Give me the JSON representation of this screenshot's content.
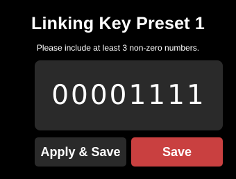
{
  "screen": {
    "title": "Linking Key Preset 1",
    "subtitle": "Please include at least 3 non-zero numbers."
  },
  "key": {
    "value": "00001111"
  },
  "buttons": {
    "apply_save_label": "Apply & Save",
    "save_label": "Save"
  },
  "colors": {
    "background": "#000000",
    "panel": "#2a2a2a",
    "save_accent": "#c94040",
    "text": "#ffffff"
  }
}
